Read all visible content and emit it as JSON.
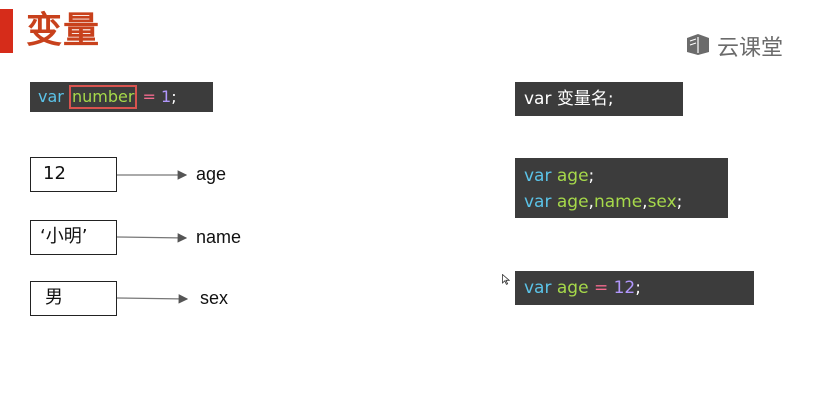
{
  "slide": {
    "title": "变量",
    "logo": {
      "icon": "book-icon",
      "text": "云课堂"
    }
  },
  "code_left": {
    "kw": "var",
    "highlighted_name": "number",
    "op": "=",
    "value": "1",
    "end": ";"
  },
  "syntax": {
    "kw": "var",
    "rest": "变量名;"
  },
  "declare": {
    "line1": {
      "kw": "var",
      "name": "age",
      "end": ";"
    },
    "line2": {
      "kw": "var",
      "n1": "age",
      "c1": ",",
      "n2": "name",
      "c2": ",",
      "n3": "sex",
      "end": ";"
    }
  },
  "assign": {
    "kw": "var",
    "name": "age",
    "op": "=",
    "value": "12",
    "end": ";"
  },
  "mappings": [
    {
      "value": "12",
      "label": "age"
    },
    {
      "value": "‘小明’",
      "label": "name"
    },
    {
      "value": "男",
      "label": "sex"
    }
  ],
  "colors": {
    "keyword": "#5bc3e8",
    "identifier": "#a6d94a",
    "operator": "#f26a8d",
    "number": "#b197fc",
    "title": "#c8411c",
    "accent_bar": "#d62c1a",
    "code_bg": "#3c3c3c"
  }
}
